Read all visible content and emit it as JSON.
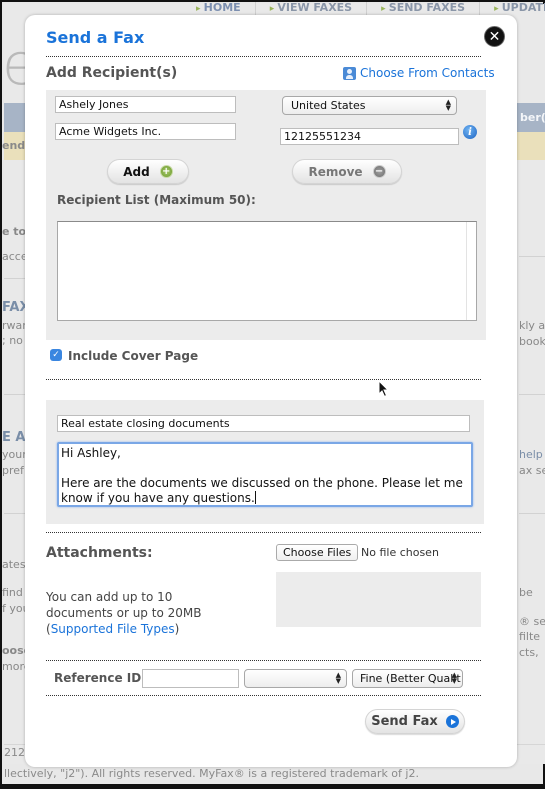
{
  "background_page": {
    "nav_items": [
      "HOME",
      "VIEW FAXES",
      "SEND FAXES",
      "UPDATE"
    ],
    "big_letter": "e",
    "yellow_bar_text": "endi",
    "blue_bar_text": "ber(",
    "left_fragments": [
      "e to",
      "acce",
      "FAX",
      "rwar",
      "; no",
      "E A",
      "your",
      "pref",
      "ates",
      "find",
      "f you",
      "oose",
      "more"
    ],
    "right_fragments": [
      "kly a",
      "book",
      "help",
      "ax se",
      "be",
      "® ser",
      "filte",
      "cts,"
    ],
    "footer_line1": "212 ,",
    "footer_line2": "llectively, \"j2\"). All rights reserved. MyFax® is a registered trademark of j2."
  },
  "modal": {
    "title": "Send a Fax",
    "close_icon": "close-icon",
    "recipients": {
      "heading": "Add Recipient(s)",
      "choose_contacts_label": "Choose From Contacts",
      "name_value": "Ashely Jones",
      "company_value": "Acme Widgets Inc.",
      "country_selected": "United States",
      "fax_number_value": "12125551234",
      "add_label": "Add",
      "remove_label": "Remove",
      "list_heading": "Recipient List (Maximum 50):",
      "list_items": []
    },
    "cover_page": {
      "label": "Include Cover Page",
      "checked": true,
      "subject_value": "Real estate closing documents",
      "message_value": "Hi Ashley,\n\nHere are the documents we discussed on the phone. Please let me know if you have any questions."
    },
    "attachments": {
      "heading": "Attachments:",
      "choose_files_label": "Choose Files",
      "file_status": "No file chosen",
      "help_line1": "You can add up to 10",
      "help_line2": "documents or up to 20MB",
      "help_open_paren": "(",
      "supported_types_link": "Supported File Types",
      "help_close_paren": ")"
    },
    "options": {
      "reference_label": "Reference ID:",
      "reference_value": "",
      "second_select_value": "",
      "quality_selected": "Fine (Better Qualit"
    },
    "send_label": "Send Fax"
  },
  "colors": {
    "accent_blue": "#1a73d9",
    "panel_gray": "#ececec",
    "add_green": "#6c9a2e"
  }
}
